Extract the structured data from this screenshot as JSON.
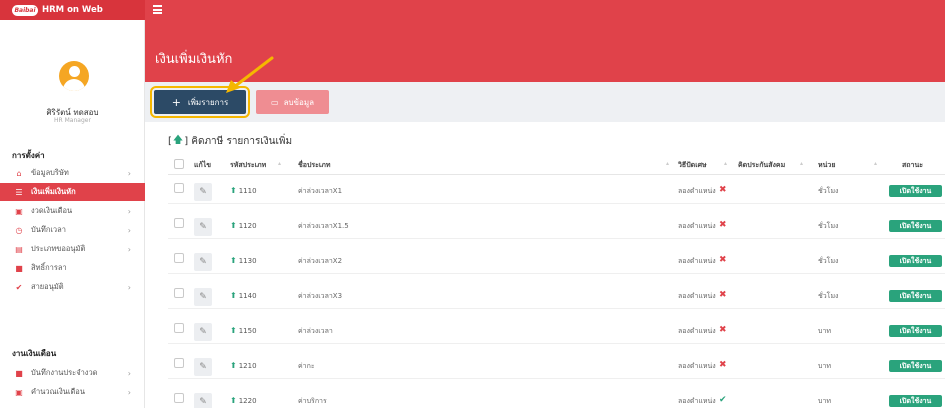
{
  "app": {
    "logo_text": "Baibai",
    "name": "HRM on Web"
  },
  "page": {
    "title": "เงินเพิ่มเงินหัก"
  },
  "user": {
    "name": "ศิริรัตน์ ทดสอบ",
    "role": "HR Manager"
  },
  "sidebar": {
    "sections": [
      {
        "heading": "การตั้งค่า",
        "items": [
          {
            "label": "ข้อมูลบริษัท",
            "icon": "home-icon",
            "chevron": true,
            "active": false
          },
          {
            "label": "เงินเพิ่มเงินหัก",
            "icon": "list-icon",
            "chevron": false,
            "active": true
          },
          {
            "label": "งวดเงินเดือน",
            "icon": "money-icon",
            "chevron": true,
            "active": false
          },
          {
            "label": "บันทึกเวลา",
            "icon": "clock-icon",
            "chevron": true,
            "active": false
          },
          {
            "label": "ประเภทขออนุมัติ",
            "icon": "calendar-icon",
            "chevron": true,
            "active": false
          },
          {
            "label": "สิทธิ์การลา",
            "icon": "document-icon",
            "chevron": false,
            "active": false
          },
          {
            "label": "สายอนุมัติ",
            "icon": "check-circle-icon",
            "chevron": true,
            "active": false
          }
        ]
      },
      {
        "heading": "งานเงินเดือน",
        "items": [
          {
            "label": "บันทึกงานประจำงวด",
            "icon": "book-icon",
            "chevron": true,
            "active": false
          },
          {
            "label": "คำนวณเงินเดือน",
            "icon": "calculator-icon",
            "chevron": true,
            "active": false
          }
        ]
      }
    ]
  },
  "toolbar": {
    "add_label": "เพิ่มรายการ",
    "delete_label": "ลบข้อมูล"
  },
  "table": {
    "section_title": "คิดภาษี รายการเงินเพิ่ม",
    "headers": {
      "edit": "แก้ไข",
      "code": "รหัสประเภท",
      "name": "ชื่อประเภท",
      "method": "วิธีปัดเศษ",
      "social": "คิดประกันสังคม",
      "unit": "หน่วย",
      "status": "สถานะ"
    },
    "rows": [
      {
        "code": "1110",
        "name": "ค่าล่วงเวลาX1",
        "method": "ลองตำแหน่ง",
        "social": false,
        "unit": "ชั่วโมง",
        "status": "เปิดใช้งาน"
      },
      {
        "code": "1120",
        "name": "ค่าล่วงเวลาX1.5",
        "method": "ลองตำแหน่ง",
        "social": false,
        "unit": "ชั่วโมง",
        "status": "เปิดใช้งาน"
      },
      {
        "code": "1130",
        "name": "ค่าล่วงเวลาX2",
        "method": "ลองตำแหน่ง",
        "social": false,
        "unit": "ชั่วโมง",
        "status": "เปิดใช้งาน"
      },
      {
        "code": "1140",
        "name": "ค่าล่วงเวลาX3",
        "method": "ลองตำแหน่ง",
        "social": false,
        "unit": "ชั่วโมง",
        "status": "เปิดใช้งาน"
      },
      {
        "code": "1150",
        "name": "ค่าล่วงเวลา",
        "method": "ลองตำแหน่ง",
        "social": false,
        "unit": "บาท",
        "status": "เปิดใช้งาน"
      },
      {
        "code": "1210",
        "name": "ค่ากะ",
        "method": "ลองตำแหน่ง",
        "social": false,
        "unit": "บาท",
        "status": "เปิดใช้งาน"
      },
      {
        "code": "1220",
        "name": "ค่าบริการ",
        "method": "ลองตำแหน่ง",
        "social": true,
        "unit": "บาท",
        "status": "เปิดใช้งาน"
      }
    ]
  },
  "colors": {
    "brand": "#e0424a",
    "primary_button": "#2c4a66",
    "success": "#2aa37c",
    "highlight": "#f5b700"
  }
}
